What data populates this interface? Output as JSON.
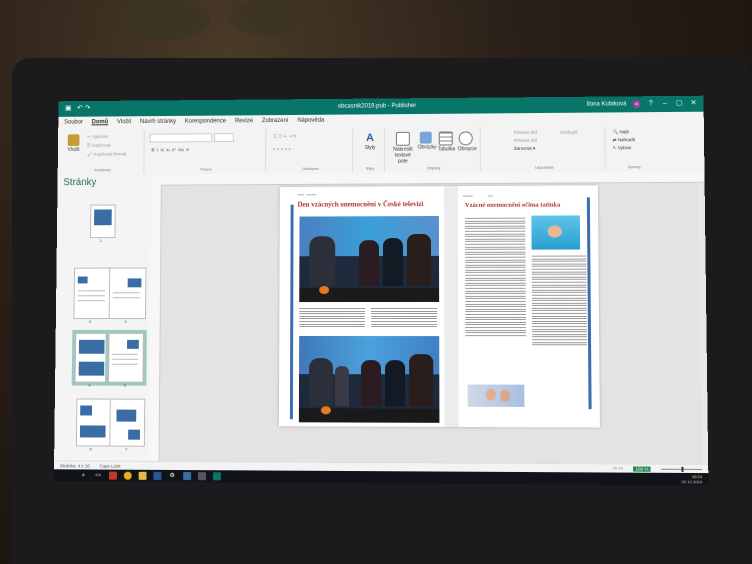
{
  "window": {
    "title": "obcasnik2019.pub - Publisher",
    "user": "Ilona Kubiková",
    "user_initials": "IK"
  },
  "menu": [
    "Soubor",
    "Domů",
    "Vložit",
    "Návrh stránky",
    "Korespondence",
    "Revize",
    "Zobrazení",
    "Nápověda"
  ],
  "ribbon": {
    "clipboard": {
      "paste": "Vložit",
      "cut": "Vyjmout",
      "copy": "Kopírovat",
      "format": "Kopírovat formát",
      "group": "Schránka"
    },
    "font_group": "Písmo",
    "paragraph_group": "Odstavec",
    "styles": {
      "label": "Styly",
      "group": "Styly"
    },
    "objects": {
      "textbox": "Nakreslit textové pole",
      "pictures": "Obrázky",
      "table": "Tabulka",
      "shapes": "Obrazce",
      "group": "Objekty"
    },
    "arrange": {
      "group_btn": "Seskupit",
      "bring": "Přenést blíž",
      "send": "Přenést dál",
      "align": "Zarovnat",
      "group": "Uspořádat"
    },
    "editing": {
      "find": "Najít",
      "replace": "Nahradit",
      "select": "Vybrat",
      "group": "Úpravy"
    }
  },
  "pages_panel": {
    "title": "Stránky",
    "thumbs": [
      "1",
      "2",
      "3",
      "4",
      "5",
      "6",
      "7"
    ]
  },
  "document": {
    "left_headline": "Den vzácných onemocnění v České televizi",
    "right_headline": "Vzácné onemocnění očima tatínka"
  },
  "status": {
    "page": "Stránka: 4 z 16",
    "caps": "Caps Lock",
    "zoom": "100 %"
  },
  "taskbar": {
    "time": "19:23",
    "date": "02.12.2019"
  }
}
